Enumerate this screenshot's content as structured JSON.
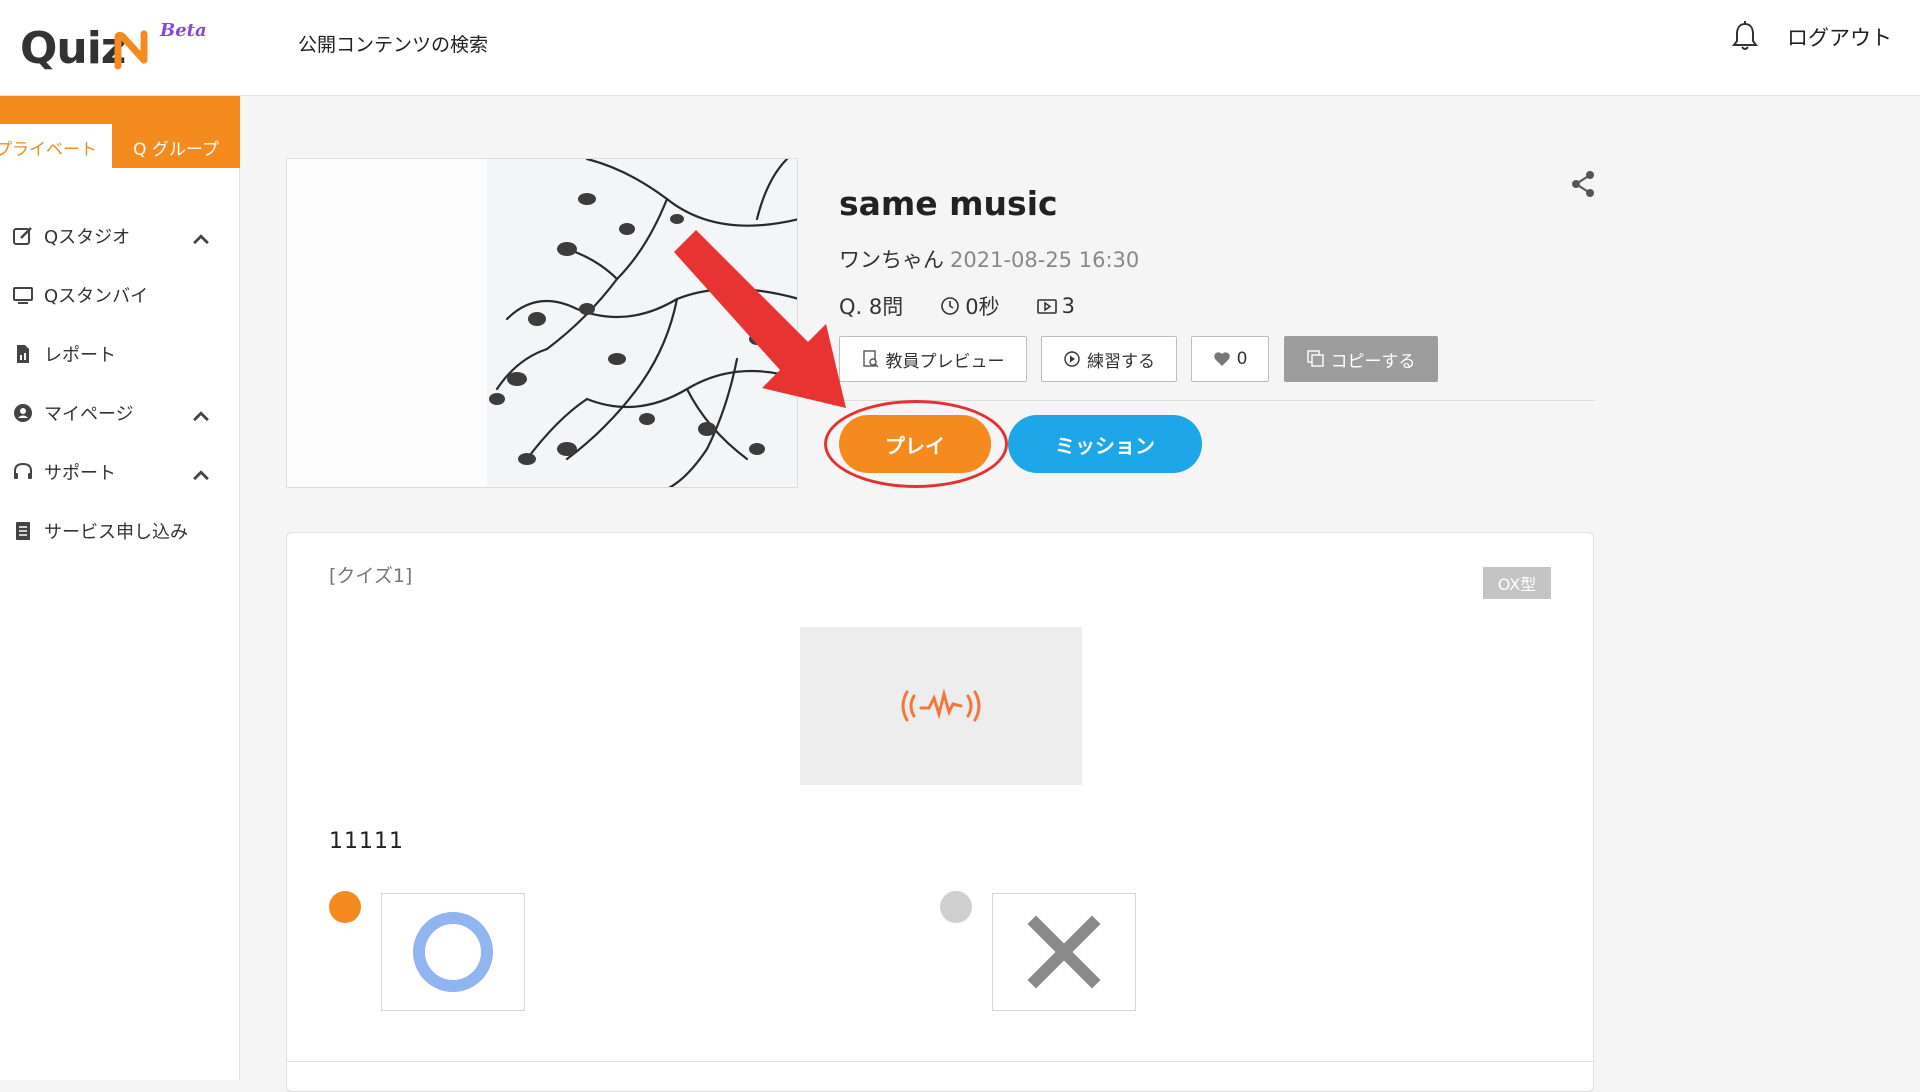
{
  "header": {
    "logo_text": "Quiz",
    "logo_beta": "Beta",
    "search_link": "公開コンテンツの検索",
    "logout_label": "ログアウト"
  },
  "sidebar": {
    "tabs": [
      {
        "label": "プライベート",
        "active": true
      },
      {
        "label": "Q グループ",
        "active": false
      }
    ],
    "items": [
      {
        "label": "Qスタジオ",
        "icon": "edit-icon",
        "expandable": true
      },
      {
        "label": "Qスタンバイ",
        "icon": "monitor-icon",
        "expandable": false
      },
      {
        "label": "レポート",
        "icon": "report-icon",
        "expandable": false
      },
      {
        "label": "マイページ",
        "icon": "user-icon",
        "expandable": true
      },
      {
        "label": "サポート",
        "icon": "headset-icon",
        "expandable": true
      },
      {
        "label": "サービス申し込み",
        "icon": "document-icon",
        "expandable": false
      }
    ]
  },
  "content": {
    "title": "same music",
    "author": "ワンちゃん",
    "date": "2021-08-25 16:30",
    "question_count": "Q. 8問",
    "time": "0秒",
    "play_count": "3",
    "buttons": {
      "preview": "教員プレビュー",
      "practice": "練習する",
      "likes": "0",
      "copy": "コピーする",
      "play": "プレイ",
      "mission": "ミッション"
    }
  },
  "quiz": {
    "label": "[クイズ1]",
    "type": "OX型",
    "question_text": "11111",
    "choices": [
      {
        "symbol": "O",
        "selected": true
      },
      {
        "symbol": "X",
        "selected": false
      }
    ]
  },
  "colors": {
    "accent": "#f58a1f",
    "mission": "#1ea7e8",
    "highlight": "#e53131"
  }
}
